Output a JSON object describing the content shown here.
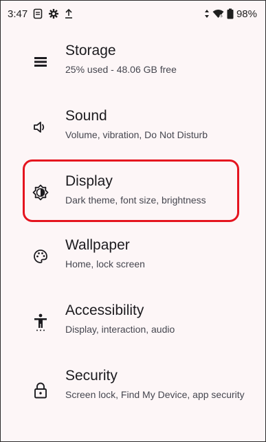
{
  "status_bar": {
    "time": "3:47",
    "battery": "98%",
    "icons": [
      "sim-icon",
      "gear-icon",
      "upload-icon",
      "vibrate-icon",
      "wifi-icon",
      "battery-icon"
    ]
  },
  "settings": [
    {
      "id": "storage",
      "title": "Storage",
      "summary": "25% used - 48.06 GB free",
      "icon": "storage-icon"
    },
    {
      "id": "sound",
      "title": "Sound",
      "summary": "Volume, vibration, Do Not Disturb",
      "icon": "speaker-icon"
    },
    {
      "id": "display",
      "title": "Display",
      "summary": "Dark theme, font size, brightness",
      "icon": "brightness-icon"
    },
    {
      "id": "wallpaper",
      "title": "Wallpaper",
      "summary": "Home, lock screen",
      "icon": "palette-icon"
    },
    {
      "id": "accessibility",
      "title": "Accessibility",
      "summary": "Display, interaction, audio",
      "icon": "accessibility-icon"
    },
    {
      "id": "security",
      "title": "Security",
      "summary": "Screen lock, Find My Device, app security",
      "icon": "lock-icon"
    }
  ],
  "colors": {
    "background": "#fdf6f7",
    "highlight": "#e5141f",
    "text_primary": "#1c1b1f",
    "text_secondary": "#45464f"
  }
}
